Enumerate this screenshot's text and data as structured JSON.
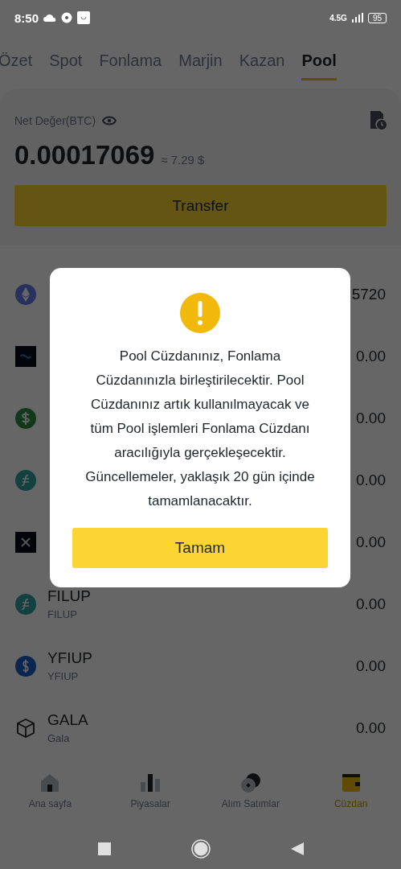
{
  "status_bar": {
    "time": "8:50",
    "network": "4.5G",
    "battery": "95"
  },
  "tabs": [
    {
      "label": "Özet",
      "selected": false
    },
    {
      "label": "Spot",
      "selected": false
    },
    {
      "label": "Fonlama",
      "selected": false
    },
    {
      "label": "Marjin",
      "selected": false
    },
    {
      "label": "Kazan",
      "selected": false
    },
    {
      "label": "Pool",
      "selected": true
    }
  ],
  "summary": {
    "label": "Net Değer(BTC)",
    "value": "0.00017069",
    "approx": "≈ 7.29 $",
    "button": "Transfer"
  },
  "coins": [
    {
      "amount": "5720",
      "kind": "eth"
    },
    {
      "amount": "0.00",
      "kind": "swirl"
    },
    {
      "amount": "0.00",
      "kind": "dollar"
    },
    {
      "amount": "0.00",
      "kind": "fil"
    },
    {
      "amount": "0.00",
      "kind": "cross"
    },
    {
      "name": "FILUP",
      "sub": "FILUP",
      "amount": "0.00",
      "kind": "fil"
    },
    {
      "name": "YFIUP",
      "sub": "YFIUP",
      "amount": "0.00",
      "kind": "yfi"
    },
    {
      "name": "GALA",
      "sub": "Gala",
      "amount": "0.00",
      "kind": "cube"
    }
  ],
  "bottom_nav": [
    {
      "label": "Ana sayfa",
      "selected": false
    },
    {
      "label": "Piyasalar",
      "selected": false
    },
    {
      "label": "Alım Satımlar",
      "selected": false
    },
    {
      "label": "Cüzdan",
      "selected": true
    }
  ],
  "dialog": {
    "message": "Pool Cüzdanınız, Fonlama Cüzdanınızla birleştirilecektir. Pool Cüzdanınız artık kullanılmayacak ve tüm Pool işlemleri Fonlama Cüzdanı aracılığıyla gerçekleşecektir. Güncellemeler, yaklaşık 20 gün içinde tamamlanacaktır.",
    "button": "Tamam"
  }
}
